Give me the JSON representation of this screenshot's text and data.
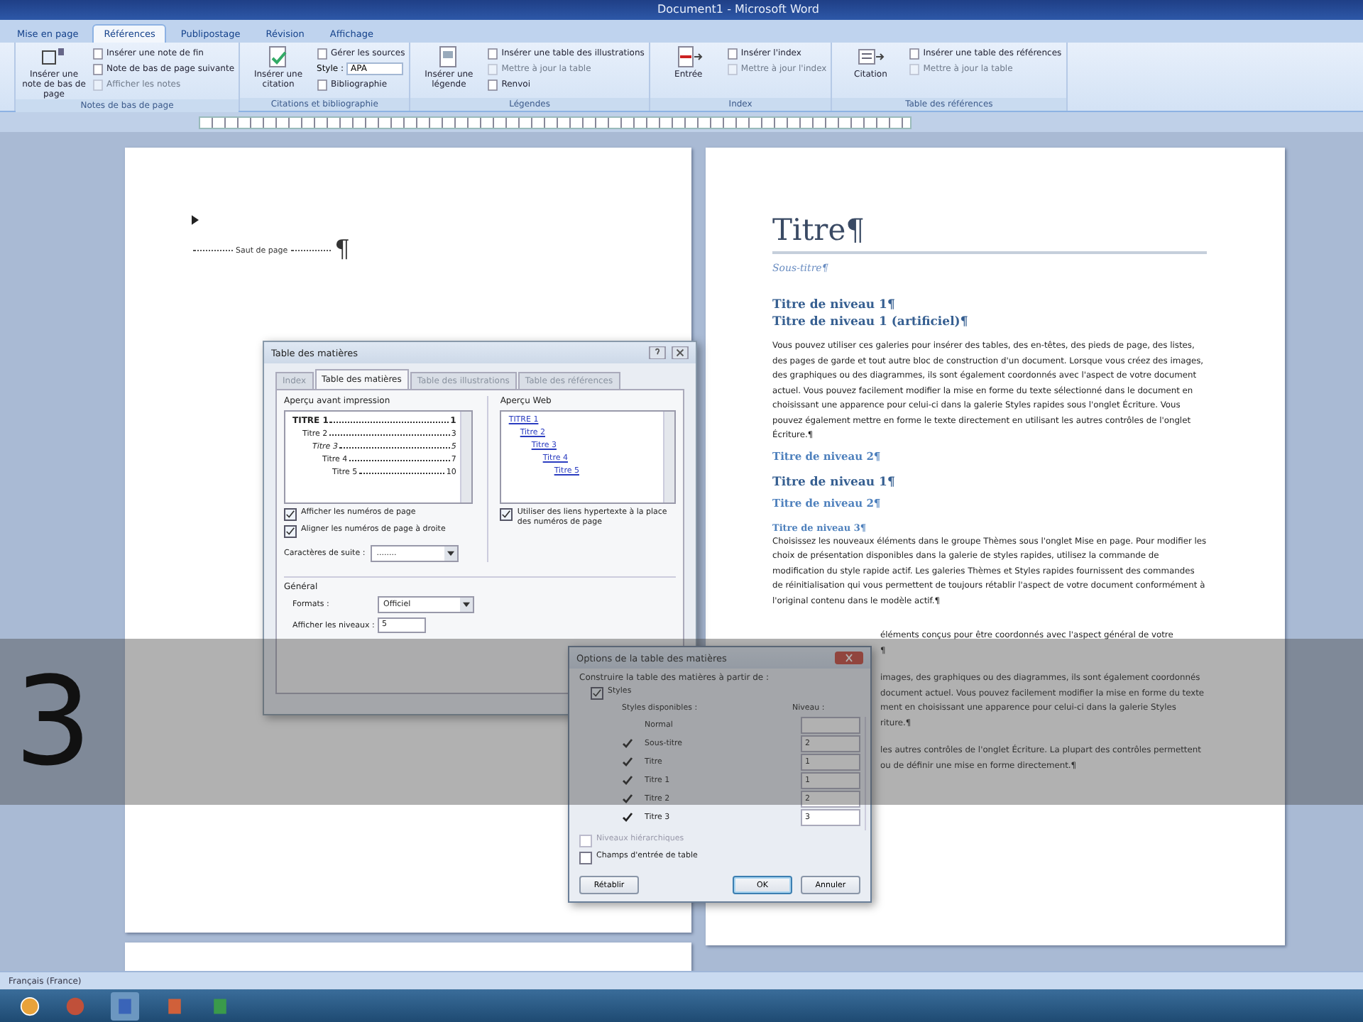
{
  "window": {
    "title": "Document1 - Microsoft Word"
  },
  "ribbon_tabs": [
    {
      "label": "Mise en page",
      "selected": false
    },
    {
      "label": "Références",
      "selected": true
    },
    {
      "label": "Publipostage",
      "selected": false
    },
    {
      "label": "Révision",
      "selected": false
    },
    {
      "label": "Affichage",
      "selected": false
    }
  ],
  "ribbon_groups": [
    {
      "label": "Notes de bas de page",
      "big_button": "Insérer une note de bas de page",
      "items": [
        {
          "kind": "button",
          "label": "Insérer une note de fin",
          "disabled": false
        },
        {
          "kind": "button",
          "label": "Note de bas de page suivante",
          "disabled": false
        },
        {
          "kind": "button",
          "label": "Afficher les notes",
          "disabled": true
        }
      ]
    },
    {
      "label": "Citations et bibliographie",
      "big_button": "Insérer une citation",
      "items": [
        {
          "kind": "button",
          "label": "Gérer les sources",
          "disabled": false
        },
        {
          "kind": "select",
          "label": "Style :",
          "value": "APA"
        },
        {
          "kind": "button",
          "label": "Bibliographie",
          "disabled": false
        }
      ]
    },
    {
      "label": "Légendes",
      "big_button": "Insérer une légende",
      "items": [
        {
          "kind": "button",
          "label": "Insérer une table des illustrations",
          "disabled": false
        },
        {
          "kind": "button",
          "label": "Mettre à jour la table",
          "disabled": true
        },
        {
          "kind": "button",
          "label": "Renvoi",
          "disabled": false
        }
      ]
    },
    {
      "label": "Index",
      "big_button": "Entrée",
      "items": [
        {
          "kind": "button",
          "label": "Insérer l'index",
          "disabled": false
        },
        {
          "kind": "button",
          "label": "Mettre à jour l'index",
          "disabled": true
        }
      ]
    },
    {
      "label": "Table des références",
      "big_button": "Citation",
      "items": [
        {
          "kind": "button",
          "label": "Insérer une table des références",
          "disabled": false
        },
        {
          "kind": "button",
          "label": "Mettre à jour la table",
          "disabled": true
        }
      ]
    }
  ],
  "left_page": {
    "page_break_label": "Saut de page",
    "pilcrow": "¶"
  },
  "right_page": {
    "blocks": [
      {
        "kind": "title",
        "text": "Titre¶"
      },
      {
        "kind": "subtitle",
        "text": "Sous-titre¶"
      },
      {
        "kind": "h1",
        "text": "Titre de niveau 1¶"
      },
      {
        "kind": "h1b",
        "text": "Titre de niveau 1 (artificiel)¶"
      },
      {
        "kind": "body",
        "text": "Vous pouvez utiliser ces galeries pour insérer des tables, des en-têtes, des pieds de page, des listes, des pages de garde et tout autre bloc de construction d'un document. Lorsque vous créez des images, des graphiques ou des diagrammes, ils sont également coordonnés avec l'aspect de votre document actuel. Vous pouvez facilement modifier la mise en forme du texte sélectionné dans le document en choisissant une apparence pour celui-ci dans la galerie Styles rapides sous l'onglet Écriture. Vous pouvez également mettre en forme le texte directement en utilisant les autres contrôles de l'onglet Écriture.¶"
      },
      {
        "kind": "h2",
        "text": "Titre de niveau 2¶"
      },
      {
        "kind": "h1",
        "text": "Titre de niveau 1¶"
      },
      {
        "kind": "h2",
        "text": "Titre de niveau 2¶"
      },
      {
        "kind": "h3",
        "text": "Titre de niveau 3¶"
      },
      {
        "kind": "body",
        "text": "Choisissez les nouveaux éléments dans le groupe Thèmes sous l'onglet Mise en page. Pour modifier les choix de présentation disponibles dans la galerie de styles rapides, utilisez la commande de modification du style rapide actif. Les galeries Thèmes et Styles rapides fournissent des commandes de réinitialisation qui vous permettent de toujours rétablir l'aspect de votre document conformément à l'original contenu dans le modèle actif.¶"
      },
      {
        "kind": "fragment",
        "text": "éléments conçus pour être coordonnés avec l'aspect général de votre"
      },
      {
        "kind": "fragment",
        "text": "¶"
      },
      {
        "kind": "gap"
      },
      {
        "kind": "fragment",
        "text": "images, des graphiques ou des diagrammes, ils sont également coordonnés"
      },
      {
        "kind": "fragment",
        "text": "document actuel. Vous pouvez facilement modifier la mise en forme du texte"
      },
      {
        "kind": "fragment",
        "text": "ment en choisissant une apparence pour celui-ci dans la galerie Styles"
      },
      {
        "kind": "fragment",
        "text": "riture.¶"
      },
      {
        "kind": "gap"
      },
      {
        "kind": "fragment",
        "text": "les autres contrôles de l'onglet Écriture. La plupart des contrôles permettent"
      },
      {
        "kind": "fragment",
        "text": "ou de définir une mise en forme directement.¶"
      }
    ]
  },
  "toc_dialog": {
    "title": "Table des matières",
    "tabs": [
      {
        "label": "Index",
        "selected": false
      },
      {
        "label": "Table des matières",
        "selected": true
      },
      {
        "label": "Table des illustrations",
        "selected": false
      },
      {
        "label": "Table des références",
        "selected": false
      }
    ],
    "print_preview": {
      "label": "Aperçu avant impression",
      "entries": [
        {
          "text": "TITRE 1",
          "page": "1",
          "children": [
            {
              "text": "Titre 2",
              "page": "3",
              "children": [
                {
                  "text": "Titre 3",
                  "page": "5",
                  "children": [
                    {
                      "text": "Titre 4",
                      "page": "7",
                      "children": [
                        {
                          "text": "Titre 5",
                          "page": "10"
                        }
                      ]
                    }
                  ]
                }
              ]
            }
          ]
        }
      ]
    },
    "print_options": [
      {
        "label": "Afficher les numéros de page",
        "checked": true
      },
      {
        "label": "Aligner les numéros de page à droite",
        "checked": true
      }
    ],
    "leader": {
      "label": "Caractères de suite :",
      "value": "........"
    },
    "web_preview": {
      "label": "Aperçu Web",
      "entries": [
        {
          "text": "TITRE 1",
          "children": [
            {
              "text": "Titre 2",
              "children": [
                {
                  "text": "Titre 3",
                  "children": [
                    {
                      "text": "Titre 4",
                      "children": [
                        {
                          "text": "Titre 5"
                        }
                      ]
                    }
                  ]
                }
              ]
            }
          ]
        }
      ]
    },
    "web_options": [
      {
        "label": "Utiliser des liens hypertexte à la place des numéros de page",
        "checked": true
      }
    ],
    "general": {
      "label": "Général",
      "format": {
        "label": "Formats :",
        "value": "Officiel"
      },
      "levels": {
        "label": "Afficher les niveaux :",
        "value": "5"
      }
    }
  },
  "options_dialog": {
    "title": "Options de la table des matières",
    "build_from": "Construire la table des matières à partir de :",
    "styles_checkbox": {
      "label": "Styles",
      "checked": true
    },
    "styles_header": "Styles disponibles :",
    "level_header": "Niveau :",
    "styles": [
      {
        "name": "Normal",
        "checked": false
      },
      {
        "name": "Sous-titre",
        "checked": true,
        "outline_level": "2"
      },
      {
        "name": "Titre",
        "checked": true,
        "outline_level": "1"
      },
      {
        "name": "Titre 1",
        "checked": true,
        "outline_level": "1"
      },
      {
        "name": "Titre 2",
        "checked": true,
        "outline_level": "2"
      },
      {
        "name": "Titre 3",
        "checked": true,
        "outline_level": "3"
      }
    ],
    "other_options": [
      {
        "label": "Niveaux hiérarchiques",
        "checked": false,
        "disabled": true
      },
      {
        "label": "Champs d'entrée de table",
        "checked": false,
        "disabled": false
      }
    ],
    "buttons": [
      {
        "label": "Rétablir",
        "kind": "reset"
      },
      {
        "label": "OK",
        "kind": "default"
      },
      {
        "label": "Annuler",
        "kind": "cancel"
      }
    ]
  },
  "video_overlay": {
    "step_number": "3"
  },
  "status_bar": {
    "language": "Français (France)"
  }
}
